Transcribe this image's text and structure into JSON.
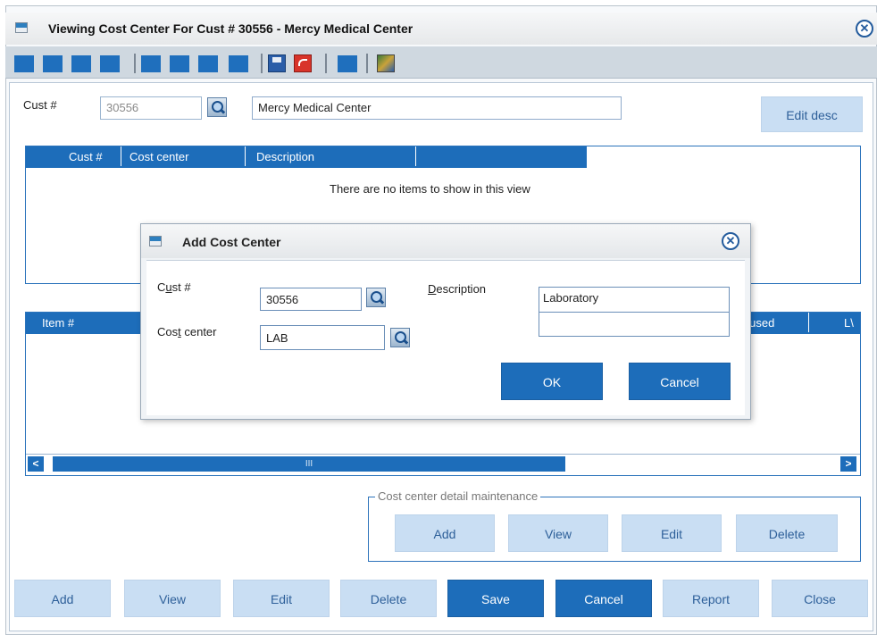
{
  "window": {
    "title": "Viewing Cost Center For Cust #  30556 - Mercy Medical Center",
    "close_icon": "circle-x-icon"
  },
  "toolbar": {
    "icons": [
      "blue-square-icon",
      "save-icon",
      "undo-icon",
      "export-icon"
    ]
  },
  "header": {
    "cust_label": "Cust #",
    "cust_value": "30556",
    "name_value": "Mercy Medical Center",
    "edit_desc_label": "Edit desc"
  },
  "cost_grid": {
    "columns": [
      "Cust #",
      "Cost center",
      "Description"
    ],
    "empty_text": "There are no items to show in this view"
  },
  "item_grid": {
    "columns_visible": [
      "Item #",
      "y used",
      "L\\"
    ],
    "scroll_thumb_label": "III"
  },
  "detail": {
    "legend": "Cost center detail maintenance",
    "add": "Add",
    "view": "View",
    "edit": "Edit",
    "delete": "Delete"
  },
  "footer": {
    "add": "Add",
    "view": "View",
    "edit": "Edit",
    "delete": "Delete",
    "save": "Save",
    "cancel": "Cancel",
    "report": "Report",
    "close": "Close"
  },
  "dialog": {
    "title": "Add Cost Center",
    "cust_label_pre": "C",
    "cust_label_u": "u",
    "cust_label_post": "st #",
    "cust_value": "30556",
    "cc_label_pre": "Cos",
    "cc_label_u": "t",
    "cc_label_post": " center",
    "cc_value": "LAB",
    "desc_label_u": "D",
    "desc_label_post": "escription",
    "desc_value": "Laboratory",
    "ok": "OK",
    "cancel": "Cancel"
  },
  "colors": {
    "accent": "#1d6dba",
    "light_button": "#c9def3"
  }
}
